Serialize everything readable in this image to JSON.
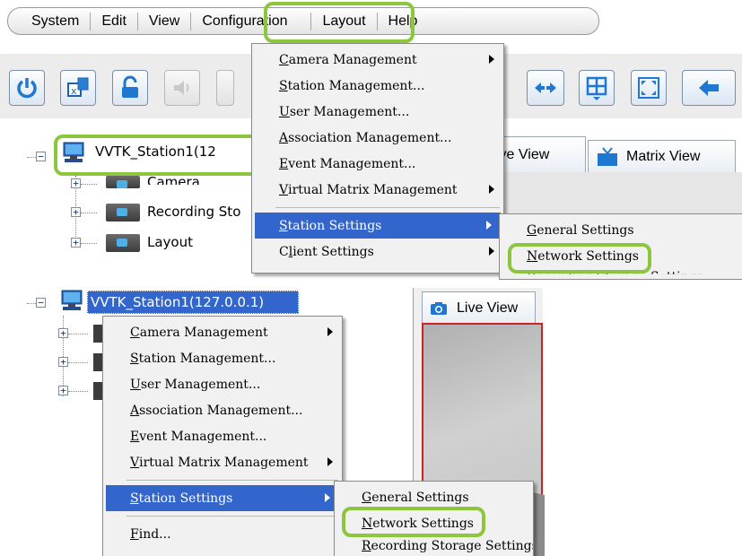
{
  "menubar": {
    "items": [
      "System",
      "Edit",
      "View",
      "Configuration",
      "Layout",
      "Help"
    ]
  },
  "tree_top": {
    "station": "VVTK_Station1(12",
    "children": [
      "Camera",
      "Recording Sto",
      "Layout"
    ]
  },
  "tree_bottom": {
    "station": "VVTK_Station1(127.0.0.1)"
  },
  "tabs": {
    "live_view": "ive View",
    "matrix_view": "Matrix View",
    "live_view_bottom": "Live View"
  },
  "config_menu": {
    "items": [
      {
        "pre": "",
        "u": "C",
        "post": "amera Management"
      },
      {
        "pre": "",
        "u": "S",
        "post": "tation Management..."
      },
      {
        "pre": "",
        "u": "U",
        "post": "ser Management..."
      },
      {
        "pre": "",
        "u": "A",
        "post": "ssociation Management..."
      },
      {
        "pre": "",
        "u": "E",
        "post": "vent Management..."
      },
      {
        "pre": "",
        "u": "V",
        "post": "irtual Matrix Management"
      },
      {
        "pre": "",
        "u": "S",
        "post": "tation Settings"
      },
      {
        "pre": "C",
        "u": "l",
        "post": "ient Settings"
      }
    ]
  },
  "station_submenu": {
    "items": [
      {
        "pre": "",
        "u": "G",
        "post": "eneral Settings"
      },
      {
        "pre": "",
        "u": "N",
        "post": "etwork Settings"
      },
      {
        "pre": "",
        "u": "R",
        "post": "ecording Storage Settings"
      }
    ]
  },
  "context_menu": {
    "items": [
      {
        "pre": "",
        "u": "C",
        "post": "amera Management"
      },
      {
        "pre": "",
        "u": "S",
        "post": "tation Management..."
      },
      {
        "pre": "",
        "u": "U",
        "post": "ser Management..."
      },
      {
        "pre": "",
        "u": "A",
        "post": "ssociation Management..."
      },
      {
        "pre": "",
        "u": "E",
        "post": "vent Management..."
      },
      {
        "pre": "",
        "u": "V",
        "post": "irtual Matrix Management"
      },
      {
        "pre": "",
        "u": "S",
        "post": "tation Settings"
      },
      {
        "pre": "",
        "u": "F",
        "post": "ind..."
      }
    ]
  },
  "colors": {
    "highlight": "#8cc63f",
    "selection": "#3366cc"
  }
}
